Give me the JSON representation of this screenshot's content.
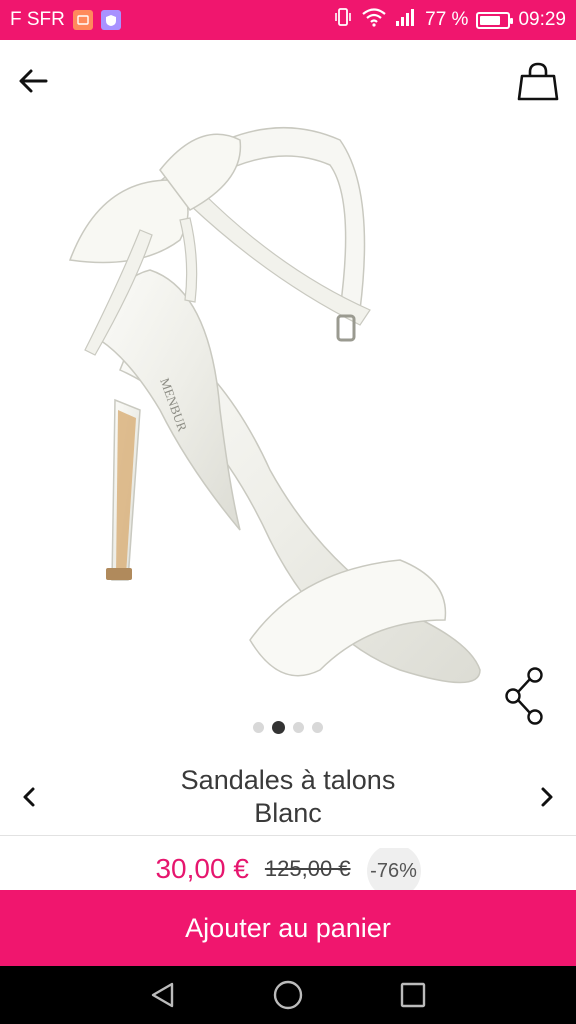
{
  "status_bar": {
    "carrier": "F SFR",
    "battery_percent": "77 %",
    "battery_level": 0.77,
    "time": "09:29",
    "icons": [
      "app-notification-icon",
      "shield-icon",
      "vibrate-icon",
      "wifi-icon",
      "signal-icon",
      "battery-icon"
    ]
  },
  "header": {
    "back_icon": "arrow-left-icon",
    "bag_icon": "shopping-bag-icon"
  },
  "product": {
    "image": "white-satin-heeled-sandal-with-bow",
    "share_icon": "share-icon",
    "pager": {
      "count": 4,
      "active_index": 1
    },
    "title_line1": "Sandales à talons",
    "title_line2": "Blanc",
    "price_current": "30,00 €",
    "price_old": "125,00 €",
    "discount": "-76%"
  },
  "cta": {
    "label": "Ajouter au panier"
  },
  "colors": {
    "brand": "#f0166e",
    "price": "#e6166e"
  },
  "nav_bar": {
    "icons": [
      "back-triangle-icon",
      "home-circle-icon",
      "recents-square-icon"
    ]
  }
}
